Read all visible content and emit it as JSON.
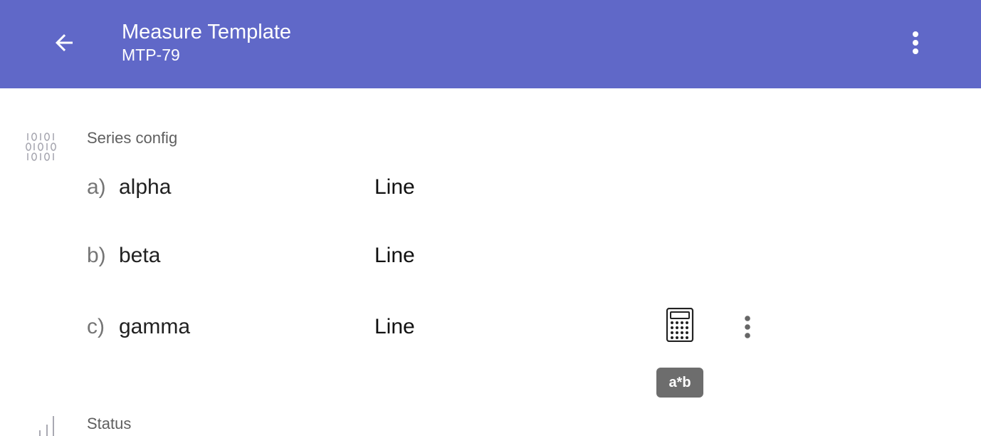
{
  "appbar": {
    "title": "Measure Template",
    "subtitle": "MTP-79",
    "back_icon": "arrow-back-icon",
    "menu_icon": "more-vert-icon",
    "background": "#6068c8"
  },
  "series_section": {
    "label": "Series config",
    "icon": "binary-icon",
    "rows": [
      {
        "letter": "a)",
        "name": "alpha",
        "type": "Line"
      },
      {
        "letter": "b)",
        "name": "beta",
        "type": "Line"
      },
      {
        "letter": "c)",
        "name": "gamma",
        "type": "Line"
      }
    ],
    "row_actions": {
      "calculator_icon": "calculator-icon",
      "menu_icon": "more-vert-icon"
    },
    "tooltip": "a*b"
  },
  "status_section": {
    "label": "Status",
    "icon": "bar-chart-icon"
  }
}
